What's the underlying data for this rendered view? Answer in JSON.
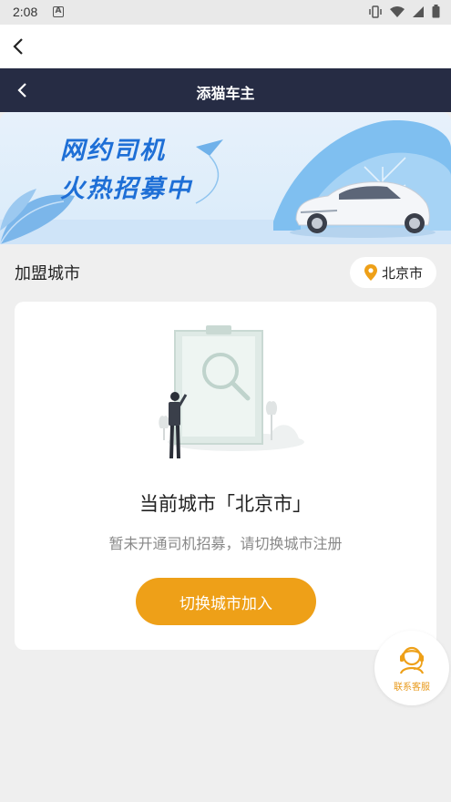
{
  "status_bar": {
    "time": "2:08",
    "notification_icon": "a-letter-icon",
    "icons": [
      "vibrate-icon",
      "wifi-icon",
      "signal-icon",
      "battery-icon"
    ]
  },
  "web_header": {
    "back_icon": "chevron-left-icon"
  },
  "app_nav": {
    "title": "添猫车主",
    "back_icon": "chevron-left-icon"
  },
  "banner": {
    "line1": "网约司机",
    "line2": "火热招募中"
  },
  "city": {
    "label": "加盟城市",
    "selected": "北京市",
    "pin_icon": "location-pin-icon"
  },
  "card": {
    "title": "当前城市「北京市」",
    "subtitle": "暂未开通司机招募，请切换城市注册",
    "button_label": "切换城市加入"
  },
  "service": {
    "label": "联系客服",
    "icon": "customer-service-icon"
  },
  "colors": {
    "nav_bg": "#262c44",
    "accent": "#eea018",
    "banner_text": "#1e6fd6"
  }
}
